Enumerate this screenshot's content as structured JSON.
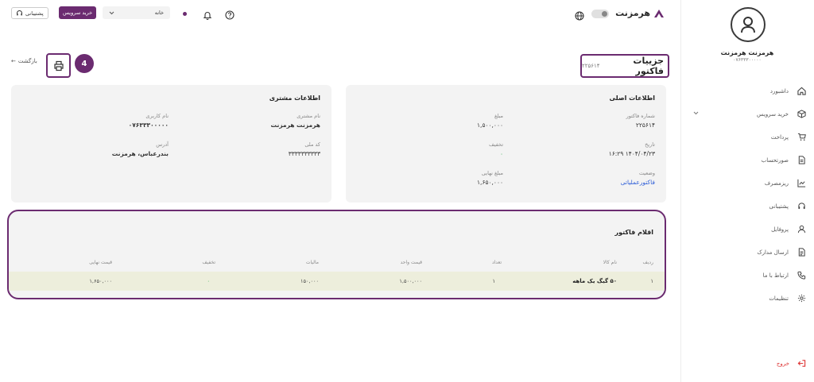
{
  "topbar": {
    "brand": "هرمزنت",
    "support_label": "پشتیبانی",
    "buy_label": "خرید سرویس",
    "home_label": "خانه"
  },
  "sidebar": {
    "user_name": "هرمزنت هرمزنت",
    "user_phone": "۰۷۶۳۳۳۰۰۰۰۰",
    "items": [
      {
        "label": "داشبورد",
        "icon": "home-icon"
      },
      {
        "label": "خرید سرویس",
        "icon": "box-icon"
      },
      {
        "label": "پرداخت",
        "icon": "cart-icon"
      },
      {
        "label": "صورتحساب",
        "icon": "invoice-icon"
      },
      {
        "label": "ریزمصرف",
        "icon": "chart-icon"
      },
      {
        "label": "پشتیبانی",
        "icon": "headset-icon"
      },
      {
        "label": "پروفایل",
        "icon": "user-icon"
      },
      {
        "label": "ارسال مدارک",
        "icon": "document-icon"
      },
      {
        "label": "ارتباط با ما",
        "icon": "phone-icon"
      },
      {
        "label": "تنظیمات",
        "icon": "gear-icon"
      }
    ],
    "logout": "خروج"
  },
  "header": {
    "title": "جزییات فاکتور",
    "invoice_number": "۲۲۵۶۱۴",
    "back_label": "بازگشت",
    "badge": "4"
  },
  "main_info": {
    "title": "اطلاعات اصلی",
    "invoice_no_label": "شماره فاکتور",
    "invoice_no": "۲۲۵۶۱۴",
    "amount_label": "مبلغ",
    "amount": "۱,۵۰۰,۰۰۰",
    "date_label": "تاریخ",
    "date": "۱۴۰۴/۰۴/۲۳ ۱۶:۲۹",
    "discount_label": "تخفیف",
    "discount": "۰",
    "status_label": "وضعیت",
    "status": "فاکتورعملیاتی",
    "final_label": "مبلغ نهایی",
    "final": "۱,۶۵۰,۰۰۰"
  },
  "customer_info": {
    "title": "اطلاعات مشتری",
    "name_label": "نام مشتری",
    "name": "هرمزنت هرمزنت",
    "username_label": "نام کاربری",
    "username": "۰۷۶۳۳۳۰۰۰۰۰",
    "national_label": "کد ملی",
    "national": "۳۳۳۳۳۳۳۳۳۳",
    "address_label": "آدرس",
    "address": "بندرعباس، هرمزنت"
  },
  "items": {
    "title": "اقلام فاکتور",
    "headers": [
      "ردیف",
      "نام کالا",
      "تعداد",
      "قیمت واحد",
      "مالیات",
      "تخفیف",
      "قیمت نهایی"
    ],
    "rows": [
      [
        "۱",
        "۵۰ گیگ یک ماهه",
        "۱",
        "۱,۵۰۰,۰۰۰",
        "۱۵۰,۰۰۰",
        "۰",
        "۱,۶۵۰,۰۰۰"
      ]
    ]
  },
  "colors": {
    "accent": "#6b2b70",
    "link": "#2a5bd7",
    "danger": "#dd3333",
    "green": "#2aa84a"
  }
}
